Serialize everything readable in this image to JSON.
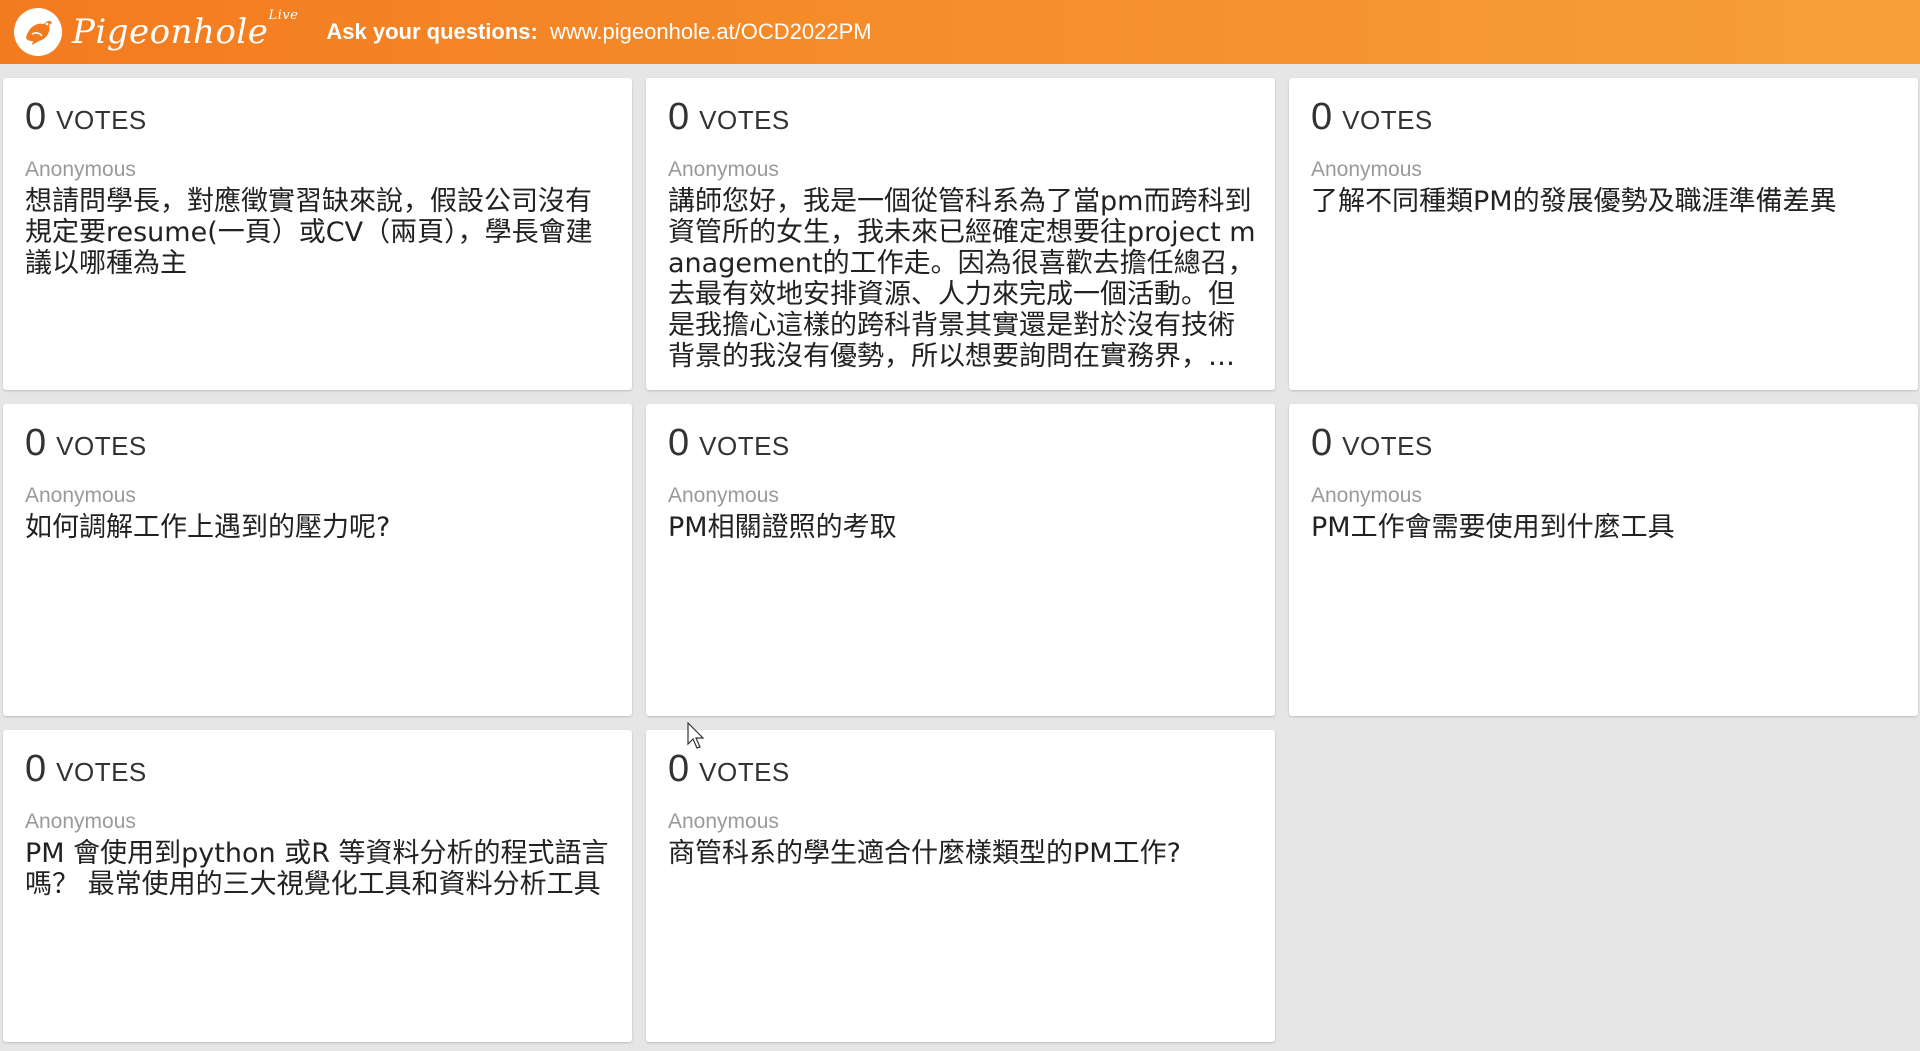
{
  "header": {
    "brand": "Pigeonhole",
    "brand_badge": "Live",
    "ask_label": "Ask your questions:",
    "ask_url": "www.pigeonhole.at/OCD2022PM",
    "logo_icon": "pigeon-logo-icon",
    "colors": {
      "bar_start": "#f37b1f",
      "bar_end": "#f7a037"
    }
  },
  "questions": [
    {
      "votes": "0",
      "votes_label": "VOTES",
      "author": "Anonymous",
      "text": "想請問學長，對應徵實習缺來說，假設公司沒有規定要resume(一頁）或CV（兩頁），學長會建議以哪種為主"
    },
    {
      "votes": "0",
      "votes_label": "VOTES",
      "author": "Anonymous",
      "text": "講師您好，我是一個從管科系為了當pm而跨科到資管所的女生，我未來已經確定想要往project management的工作走。因為很喜歡去擔任總召，去最有效地安排資源、人力來完成一個活動。但是我擔心這樣的跨科背景其實還是對於沒有技術背景的我沒有優勢，所以想要詢問在實務界，我應該..."
    },
    {
      "votes": "0",
      "votes_label": "VOTES",
      "author": "Anonymous",
      "text": "了解不同種類PM的發展優勢及職涯準備差異"
    },
    {
      "votes": "0",
      "votes_label": "VOTES",
      "author": "Anonymous",
      "text": "如何調解工作上遇到的壓力呢?"
    },
    {
      "votes": "0",
      "votes_label": "VOTES",
      "author": "Anonymous",
      "text": "PM相關證照的考取"
    },
    {
      "votes": "0",
      "votes_label": "VOTES",
      "author": "Anonymous",
      "text": "PM工作會需要使用到什麼工具"
    },
    {
      "votes": "0",
      "votes_label": "VOTES",
      "author": "Anonymous",
      "text": "PM 會使用到python 或R 等資料分析的程式語言嗎？ 最常使用的三大視覺化工具和資料分析工具"
    },
    {
      "votes": "0",
      "votes_label": "VOTES",
      "author": "Anonymous",
      "text": "商管科系的學生適合什麼樣類型的PM工作?"
    }
  ]
}
